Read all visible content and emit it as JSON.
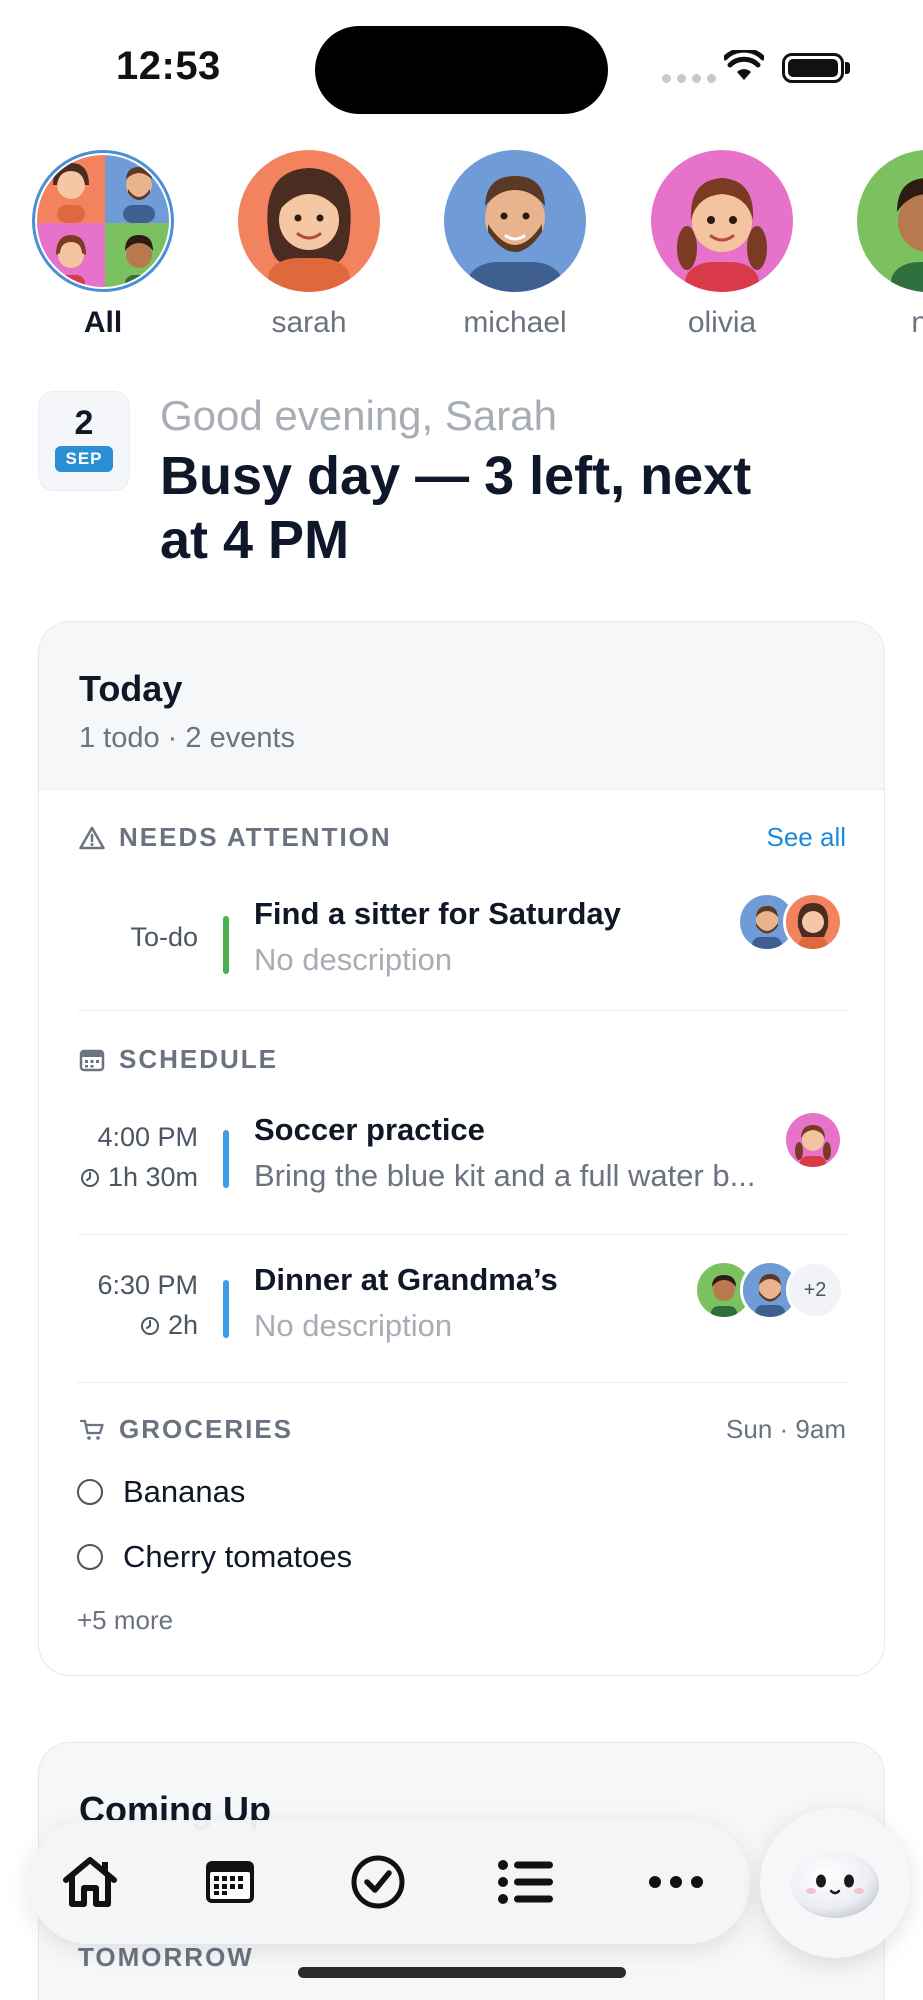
{
  "status_bar": {
    "time": "12:53"
  },
  "members": [
    {
      "name": "All",
      "active": true
    },
    {
      "name": "sarah",
      "color": "#f3835e"
    },
    {
      "name": "michael",
      "color": "#6f9bd6"
    },
    {
      "name": "olivia",
      "color": "#e772c9"
    },
    {
      "name": "no",
      "color": "#7cc15f"
    }
  ],
  "greeting": {
    "date_day": "2",
    "date_month": "SEP",
    "subtitle": "Good evening, Sarah",
    "headline": "Busy day — 3 left, next at 4 PM"
  },
  "today": {
    "title": "Today",
    "summary": "1 todo · 2 events",
    "needs_attention": {
      "label": "NEEDS ATTENTION",
      "see_all": "See all",
      "items": [
        {
          "kind": "To-do",
          "title": "Find a sitter for Saturday",
          "description": "No description",
          "bar_color": "#4caf50"
        }
      ]
    },
    "schedule": {
      "label": "SCHEDULE",
      "events": [
        {
          "time": "4:00 PM",
          "duration": "1h 30m",
          "title": "Soccer practice",
          "description": "Bring the blue kit and a full water b...",
          "bar_color": "#3b9ee6"
        },
        {
          "time": "6:30 PM",
          "duration": "2h",
          "title": "Dinner at Grandma’s",
          "description": "No description",
          "bar_color": "#3b9ee6",
          "extra_count": "+2"
        }
      ]
    },
    "groceries": {
      "label": "GROCERIES",
      "when": "Sun · 9am",
      "items": [
        "Bananas",
        "Cherry tomatoes"
      ],
      "more": "+5 more"
    }
  },
  "coming_up": {
    "title": "Coming Up",
    "section": "TOMORROW"
  },
  "tabbar": {
    "tabs": [
      "home-icon",
      "calendar-icon",
      "check-circle-icon",
      "list-icon",
      "more-icon"
    ]
  },
  "colors": {
    "accent": "#1c8ad9",
    "todo_bar": "#4caf50",
    "event_bar": "#3b9ee6"
  }
}
